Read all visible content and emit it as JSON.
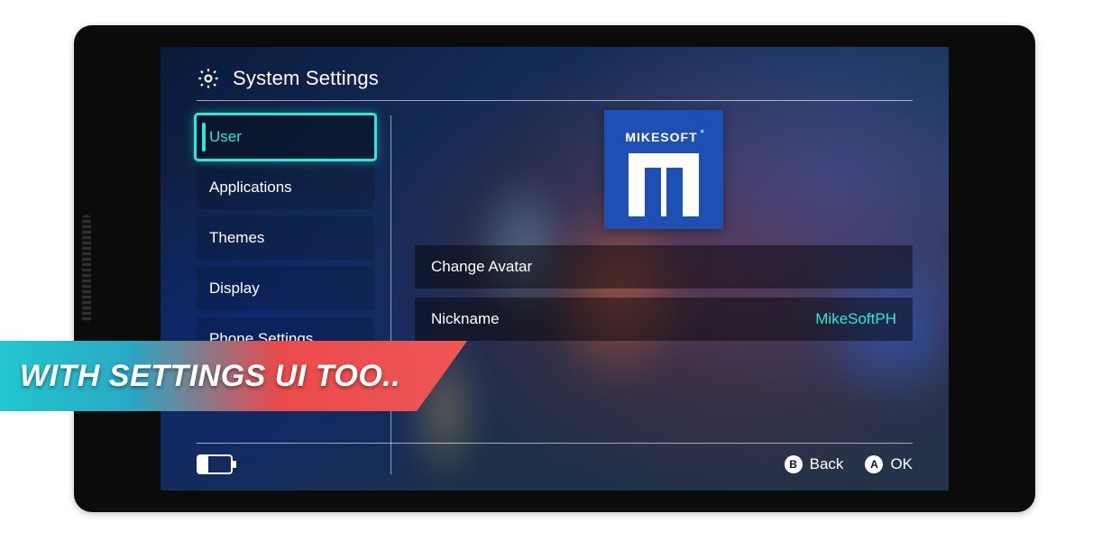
{
  "header": {
    "title": "System Settings"
  },
  "sidebar": {
    "items": [
      {
        "label": "User",
        "selected": true
      },
      {
        "label": "Applications",
        "selected": false
      },
      {
        "label": "Themes",
        "selected": false
      },
      {
        "label": "Display",
        "selected": false
      },
      {
        "label": "Phone Settings",
        "selected": false
      }
    ]
  },
  "avatar": {
    "brand": "MIKESOFT"
  },
  "rows": [
    {
      "label": "Change Avatar",
      "value": ""
    },
    {
      "label": "Nickname",
      "value": "MikeSoftPH"
    }
  ],
  "footer": {
    "back": {
      "glyph": "B",
      "label": "Back"
    },
    "ok": {
      "glyph": "A",
      "label": "OK"
    }
  },
  "promo": {
    "text": "WITH SETTINGS UI TOO.."
  },
  "colors": {
    "accent": "#2fe7d6"
  }
}
